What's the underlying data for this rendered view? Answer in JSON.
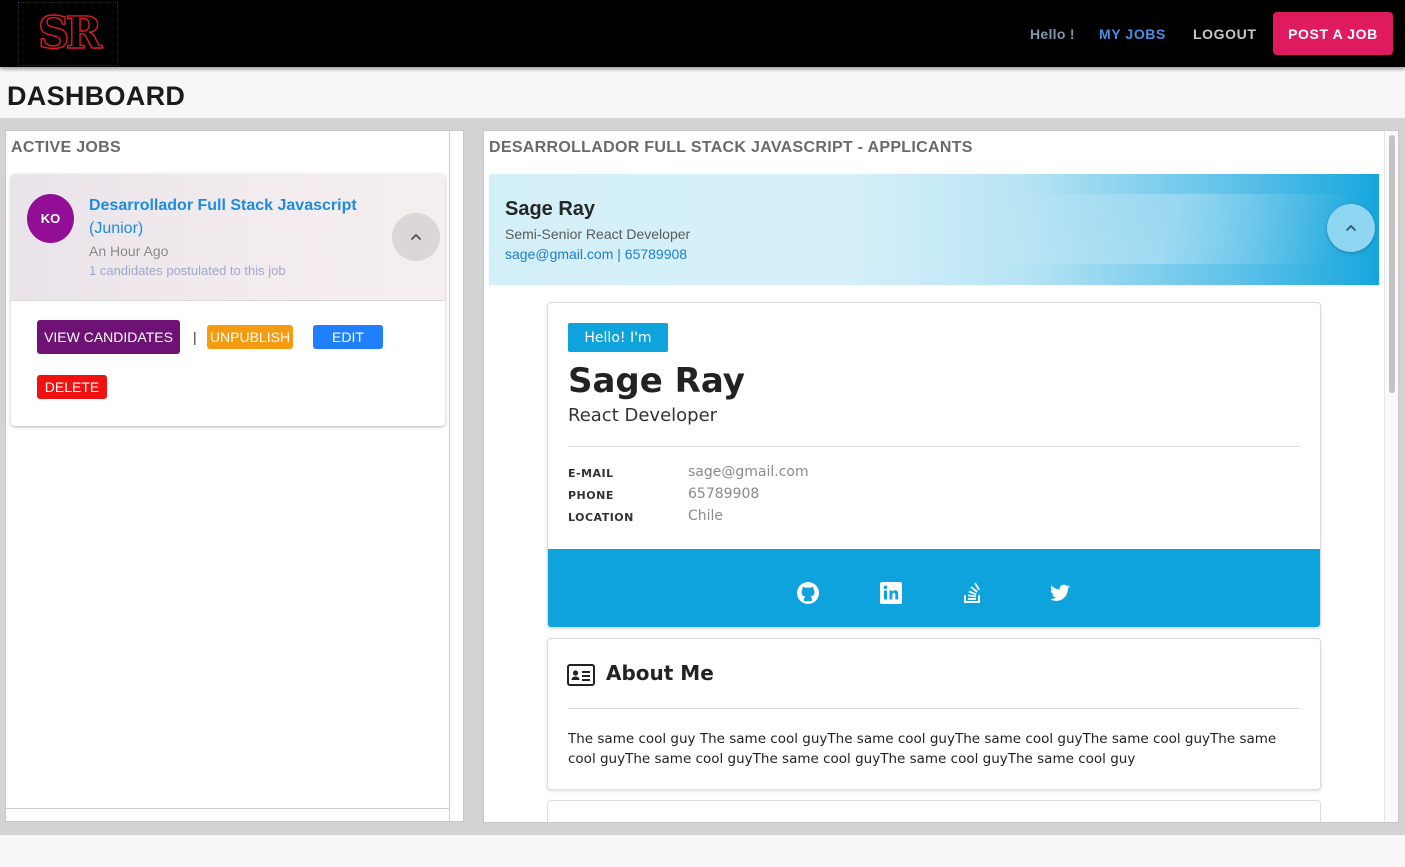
{
  "navbar": {
    "logo_text": "SR",
    "hello": "Hello !",
    "my_jobs": "MY JOBS",
    "logout": "LOGOUT",
    "post_job": "POST A JOB"
  },
  "page": {
    "title": "DASHBOARD"
  },
  "active_jobs": {
    "title": "ACTIVE JOBS",
    "job": {
      "avatar": "KO",
      "title": "Desarrollador Full Stack Javascript",
      "level": "(Junior)",
      "posted": "An Hour Ago",
      "candidates": "1 candidates postulated to this job",
      "buttons": {
        "view": "VIEW CANDIDATES",
        "separator": "|",
        "unpublish": "UNPUBLISH",
        "edit": "EDIT",
        "delete": "DELETE"
      }
    }
  },
  "applicants": {
    "title": "DESARROLLADOR FULL STACK JAVASCRIPT - APPLICANTS",
    "applicant": {
      "name": "Sage Ray",
      "role": "Semi-Senior React Developer",
      "contact": "sage@gmail.com | 65789908"
    },
    "profile": {
      "hello": "Hello! I'm",
      "name": "Sage Ray",
      "role": "React Developer",
      "email_label": "E-MAIL",
      "email": "sage@gmail.com",
      "phone_label": "PHONE",
      "phone": "65789908",
      "location_label": "LOCATION",
      "location": "Chile",
      "social_icons": [
        "github-icon",
        "linkedin-icon",
        "stackoverflow-icon",
        "twitter-icon"
      ]
    },
    "about": {
      "title": "About Me",
      "text": "The same cool guy The same cool guyThe same cool guyThe same cool guyThe same cool guyThe same cool guyThe same cool guyThe same cool guyThe same cool guyThe same cool guy"
    }
  },
  "colors": {
    "nav_bg": "#000000",
    "post_job": "#e01a5f",
    "avatar": "#920e97",
    "link_blue": "#1d8ce0",
    "view_btn": "#6f1276",
    "unpublish_btn": "#f49b12",
    "edit_btn": "#1f7fff",
    "delete_btn": "#f01111",
    "profile_accent": "#0ea3dc"
  }
}
